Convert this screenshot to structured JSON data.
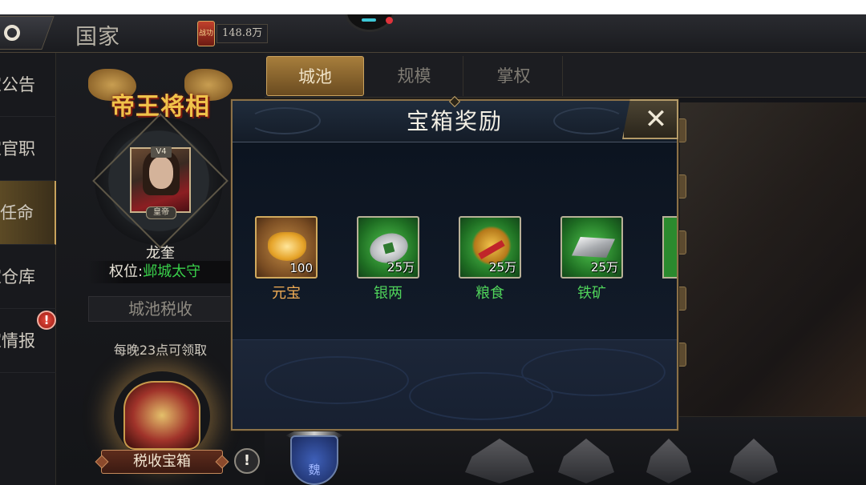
{
  "header": {
    "title": "国家",
    "power_badge": "战功",
    "power_value": "148.8万"
  },
  "left_menu": {
    "items": [
      {
        "label": "国家公告",
        "visible": "家公告"
      },
      {
        "label": "国家官职",
        "visible": "家官职"
      },
      {
        "label": "国家任命",
        "visible": "家任命"
      },
      {
        "label": "国家仓库",
        "visible": "家仓库"
      },
      {
        "label": "国家情报",
        "visible": "家情报"
      }
    ],
    "active_index": 2,
    "alert": "!"
  },
  "profile": {
    "emblem_text": "帝王将相",
    "vip": "V4",
    "rank_tag": "皇帝",
    "name": "龙奎",
    "position_label": "权位:",
    "position_value": "邺城太守",
    "tax_title": "城池税收",
    "tax_info": "每晚23点可领取",
    "chest_button": "税收宝箱",
    "info_icon": "!"
  },
  "tabs": [
    {
      "label": "城池",
      "active": true
    },
    {
      "label": "规模",
      "active": false
    },
    {
      "label": "掌权",
      "active": false
    }
  ],
  "city_emblem_text": "魏",
  "modal": {
    "title": "宝箱奖励",
    "close_symbol": "✕",
    "items": [
      {
        "name": "元宝",
        "qty": "100",
        "rarity": "gold",
        "icon": "gold-ingot-icon"
      },
      {
        "name": "银两",
        "qty": "25万",
        "rarity": "green",
        "icon": "silver-coin-icon"
      },
      {
        "name": "粮食",
        "qty": "25万",
        "rarity": "green",
        "icon": "grain-bundle-icon"
      },
      {
        "name": "铁矿",
        "qty": "25万",
        "rarity": "green",
        "icon": "iron-ingot-icon"
      }
    ]
  },
  "colors": {
    "gold_accent": "#c7a25e",
    "green_rarity": "#4fd25a",
    "gold_rarity": "#f2ad55",
    "position_green": "#39d04a"
  }
}
